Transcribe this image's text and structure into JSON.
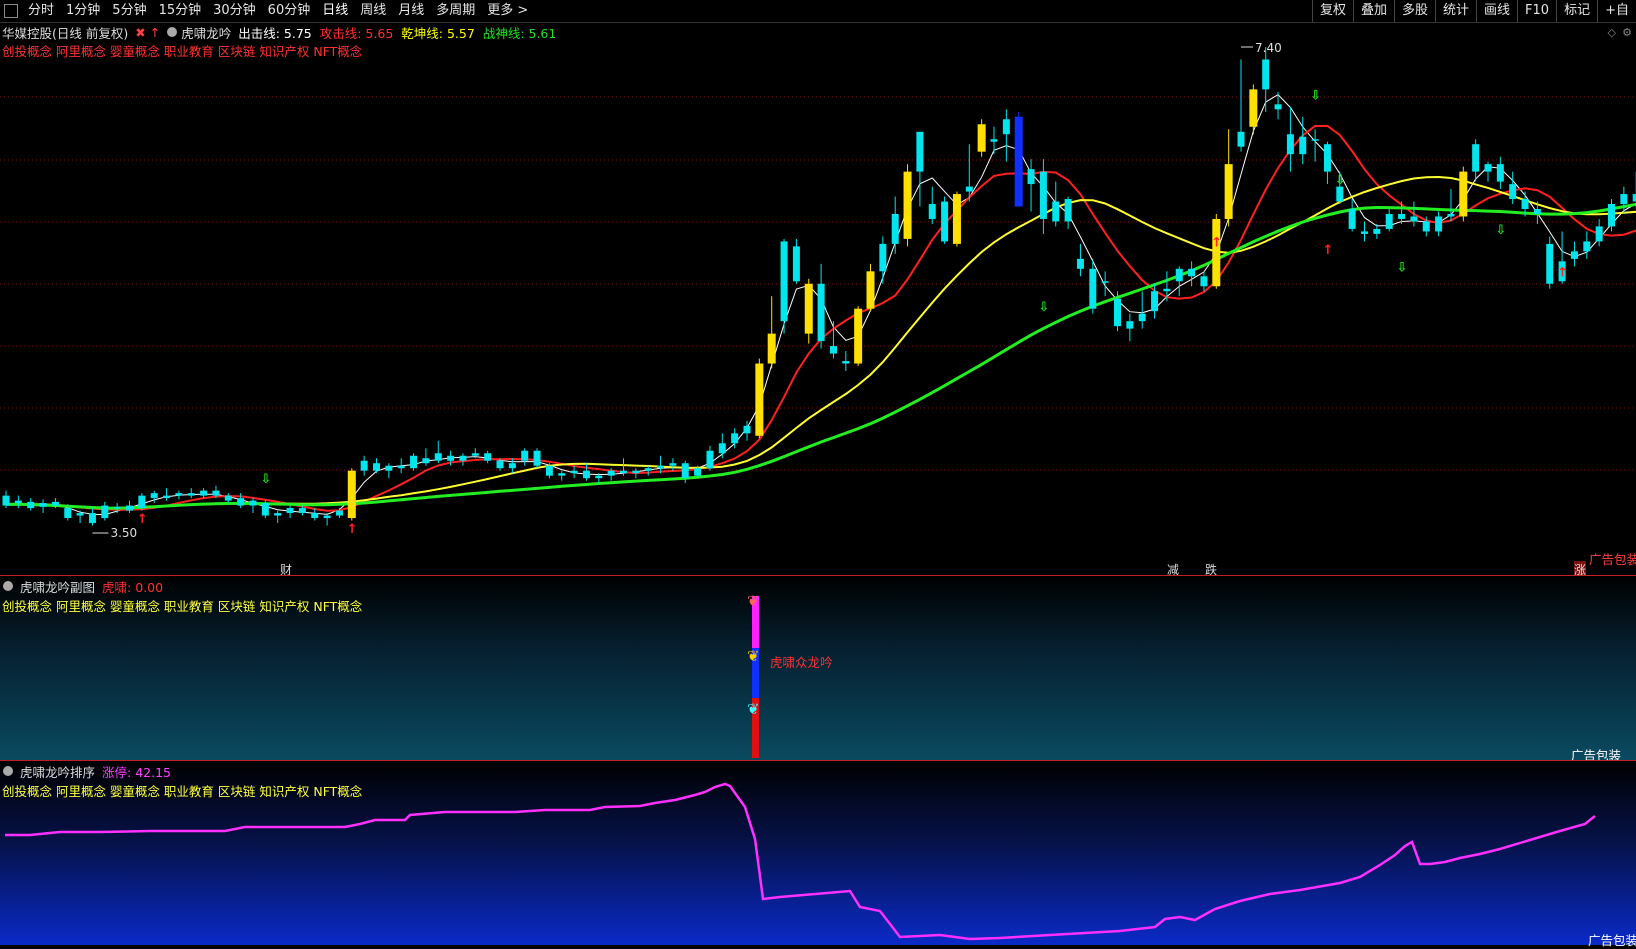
{
  "toolbar": {
    "periods": [
      "分时",
      "1分钟",
      "5分钟",
      "15分钟",
      "30分钟",
      "60分钟",
      "日线",
      "周线",
      "月线",
      "多周期",
      "更多 >"
    ],
    "active": "日线",
    "right": [
      "复权",
      "叠加",
      "多股",
      "统计",
      "画线",
      "F10",
      "标记",
      "+自"
    ]
  },
  "main_panel": {
    "stock": "华媒控股(日线 前复权)",
    "indicator": "虎啸龙吟",
    "values": [
      {
        "label": "出击线: 5.75",
        "color": "#ffffff"
      },
      {
        "label": "攻击线: 5.65",
        "color": "#ff3030"
      },
      {
        "label": "乾坤线: 5.57",
        "color": "#ffff00"
      },
      {
        "label": "战神线: 5.61",
        "color": "#20e020"
      }
    ],
    "concepts": "创投概念 阿里概念 婴童概念 职业教育 区块链 知识产权 NFT概念",
    "high_label": "7.40",
    "low_label": "3.50",
    "ad_text": "广告包装",
    "bottom_markers": [
      {
        "text": "财",
        "color": "#6fa8ff"
      },
      {
        "text": "减",
        "color": "#20e020"
      },
      {
        "text": "跌",
        "color": "#20e020"
      },
      {
        "text": "涨",
        "color": "#ff5050"
      }
    ]
  },
  "sub_panel": {
    "title": "虎啸龙吟副图",
    "value": "虎啸: 0.00",
    "concepts": "创投概念 阿里概念 婴童概念 职业教育 区块链 知识产权 NFT概念",
    "signal_text": "虎啸众龙吟",
    "ad_text": "广告包装"
  },
  "rank_panel": {
    "title": "虎啸龙吟排序",
    "value": "涨停: 42.15",
    "concepts": "创投概念 阿里概念 婴童概念 职业教育 区块链 知识产权 NFT概念",
    "ad_text": "广告包装"
  },
  "colors": {
    "up": "#00e5ee",
    "down": "#00e5ee",
    "yellow_bar": "#ffe000",
    "blue_bar": "#1030ff",
    "ma_white": "#ffffff",
    "ma_red": "#ff2020",
    "ma_yellow": "#ffff30",
    "ma_green": "#22ee22",
    "rank_line": "#ff30ff"
  }
}
